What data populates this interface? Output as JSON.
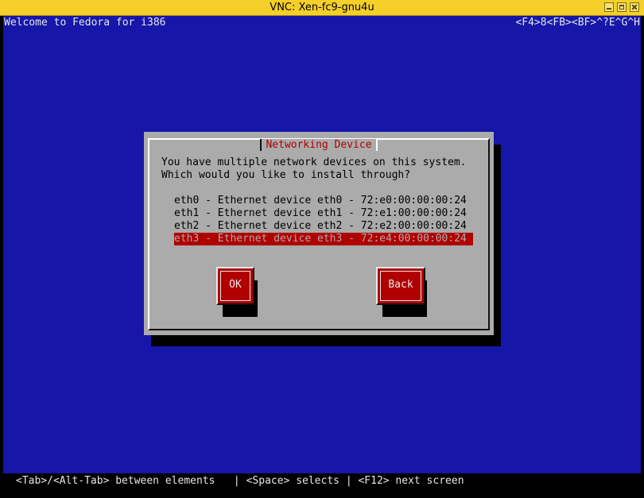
{
  "window": {
    "title": "VNC: Xen-fc9-gnu4u"
  },
  "console": {
    "top_left": "Welcome to Fedora for i386",
    "top_right": "<F4>8<FB><BF>^?E^G^H",
    "bottom_hint": "<Tab>/<Alt-Tab> between elements   | <Space> selects | <F12> next screen"
  },
  "dialog": {
    "title": "Networking Device",
    "prompt_line1": "You have multiple network devices on this system.",
    "prompt_line2": "Which would you like to install through?",
    "devices": [
      "eth0 - Ethernet device eth0 - 72:e0:00:00:00:24",
      "eth1 - Ethernet device eth1 - 72:e1:00:00:00:24",
      "eth2 - Ethernet device eth2 - 72:e2:00:00:00:24",
      "eth3 - Ethernet device eth3 - 72:e4:00:00:00:24"
    ],
    "selected_index": 3,
    "ok_label": "OK",
    "back_label": "Back"
  }
}
